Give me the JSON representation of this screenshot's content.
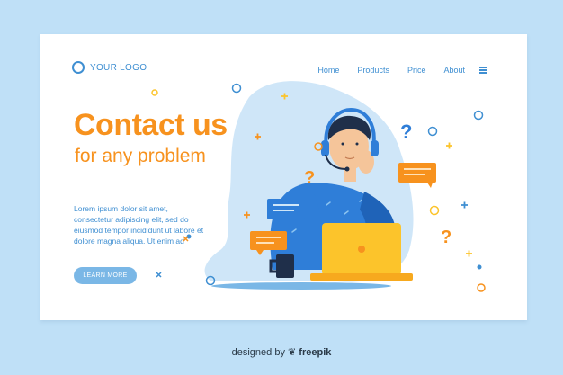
{
  "logo": {
    "text": "YOUR LOGO"
  },
  "nav": {
    "items": [
      "Home",
      "Products",
      "Price",
      "About"
    ]
  },
  "hero": {
    "headline": "Contact us",
    "subheadline": "for any problem",
    "body": "Lorem ipsum dolor sit amet, consectetur adipiscing elit, sed do eiusmod tempor incididunt ut labore et dolore magna aliqua. Ut enim ad",
    "cta_label": "LEARN MORE"
  },
  "footer": {
    "prefix": "designed by",
    "brand": "freepik"
  },
  "colors": {
    "page_bg": "#bfe0f7",
    "accent_blue": "#3f8fd2",
    "accent_orange": "#f7921e",
    "blob": "#cfe6f8",
    "laptop": "#fcc42b"
  }
}
